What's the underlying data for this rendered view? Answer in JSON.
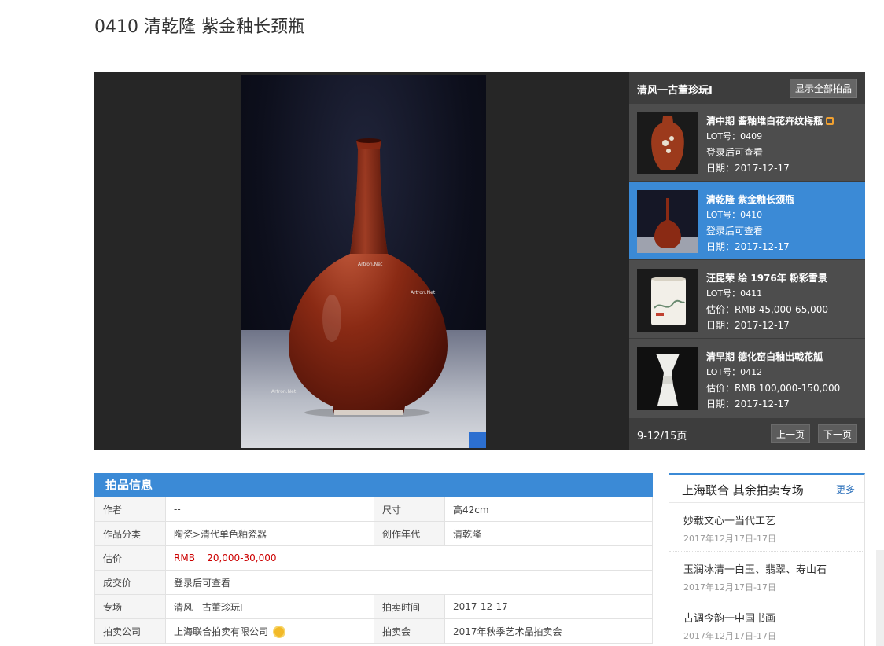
{
  "page": {
    "title": "0410 清乾隆 紫金釉长颈瓶"
  },
  "viewer": {
    "image_alt": "紫金釉长颈瓶",
    "watermark": "Artron.Net"
  },
  "sidepanel": {
    "title": "清风一古董珍玩I",
    "show_all_label": "显示全部拍品",
    "lots": [
      {
        "name": "清中期 酱釉堆白花卉纹梅瓶",
        "lot": "LOT号：0409",
        "price": "登录后可查看",
        "date": "日期：2017-12-17"
      },
      {
        "name": "清乾隆 紫金釉长颈瓶",
        "lot": "LOT号：0410",
        "price": "登录后可查看",
        "date": "日期：2017-12-17"
      },
      {
        "name": "汪昆荣 绘 1976年 粉彩雪景",
        "lot": "LOT号：0411",
        "price": "估价：RMB 45,000-65,000",
        "date": "日期：2017-12-17"
      },
      {
        "name": "清早期 德化窑白釉出戟花觚",
        "lot": "LOT号：0412",
        "price": "估价：RMB 100,000-150,000",
        "date": "日期：2017-12-17"
      }
    ],
    "page_info": "9-12/15页",
    "prev_label": "上一页",
    "next_label": "下一页"
  },
  "info": {
    "heading": "拍品信息",
    "author_label": "作者",
    "author": "--",
    "size_label": "尺寸",
    "size": "高42cm",
    "category_label": "作品分类",
    "category": "陶瓷>清代单色釉瓷器",
    "era_label": "创作年代",
    "era": "清乾隆",
    "estimate_label": "估价",
    "estimate_currency": "RMB",
    "estimate_value": "20,000-30,000",
    "deal_label": "成交价",
    "deal": "登录后可查看",
    "session_label": "专场",
    "session": "清风一古董珍玩I",
    "time_label": "拍卖时间",
    "time": "2017-12-17",
    "company_label": "拍卖公司",
    "company": "上海联合拍卖有限公司",
    "auction_label": "拍卖会",
    "auction": "2017年秋季艺术品拍卖会"
  },
  "other": {
    "title": "上海联合 其余拍卖专场",
    "more": "更多",
    "items": [
      {
        "name": "妙载文心一当代工艺",
        "date": "2017年12月17日-17日"
      },
      {
        "name": "玉润冰清一白玉、翡翠、寿山石",
        "date": "2017年12月17日-17日"
      },
      {
        "name": "古调今韵一中国书画",
        "date": "2017年12月17日-17日"
      }
    ]
  },
  "colors": {
    "accent": "#3b8ad6",
    "estimate_red": "#cc0000",
    "vase": "#8a2a14"
  }
}
